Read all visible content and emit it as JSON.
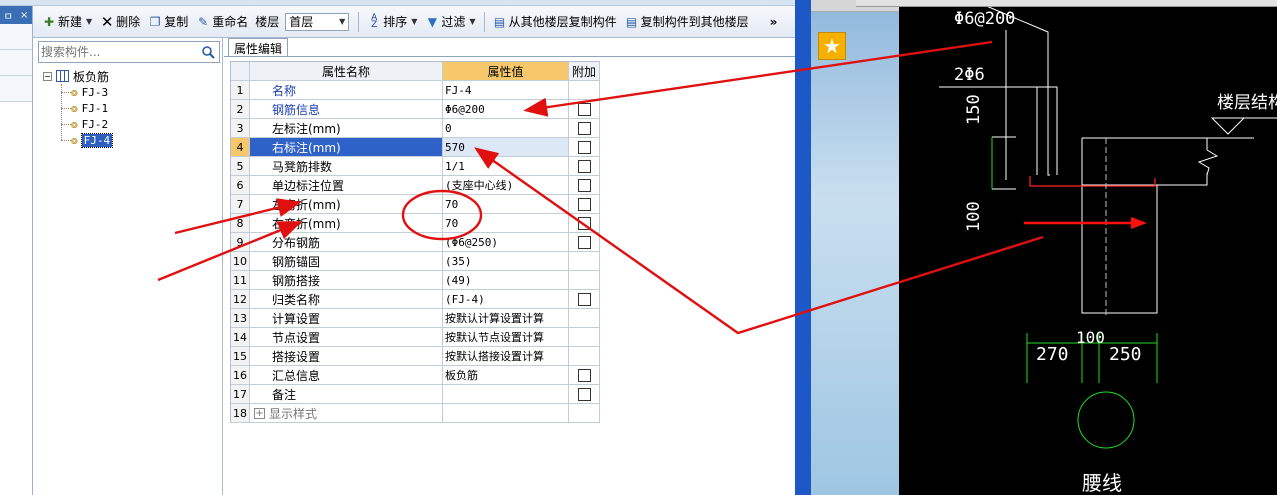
{
  "toolbar": {
    "new_label": "新建",
    "delete_label": "删除",
    "copy_label": "复制",
    "rename_label": "重命名",
    "floor_label": "楼层",
    "floor_value": "首层",
    "sort_label": "排序",
    "filter_label": "过滤",
    "copy_from_floor_label": "从其他楼层复制构件",
    "copy_to_floor_label": "复制构件到其他楼层",
    "more_label": "»"
  },
  "left_stub": {
    "pin_label": "ㅁ",
    "close_label": "×"
  },
  "search": {
    "placeholder": "搜索构件..."
  },
  "tree": {
    "root_label": "板负筋",
    "items": [
      {
        "label": "FJ-3"
      },
      {
        "label": "FJ-1"
      },
      {
        "label": "FJ-2"
      },
      {
        "label": "FJ-4",
        "selected": true
      }
    ]
  },
  "property_panel": {
    "tab_label": "属性编辑",
    "headers": {
      "name": "属性名称",
      "value": "属性值",
      "extra": "附加"
    },
    "rows": [
      {
        "n": "1",
        "name": "名称",
        "value": "FJ-4",
        "style": "blue",
        "checkbox": false
      },
      {
        "n": "2",
        "name": "钢筋信息",
        "value": "Φ6@200",
        "style": "blue",
        "checkbox": true
      },
      {
        "n": "3",
        "name": "左标注(mm)",
        "value": "0",
        "style": "",
        "checkbox": true
      },
      {
        "n": "4",
        "name": "右标注(mm)",
        "value": "570",
        "style": "selected",
        "checkbox": true
      },
      {
        "n": "5",
        "name": "马凳筋排数",
        "value": "1/1",
        "style": "",
        "checkbox": true
      },
      {
        "n": "6",
        "name": "单边标注位置",
        "value": "(支座中心线)",
        "style": "",
        "checkbox": true
      },
      {
        "n": "7",
        "name": "左弯折(mm)",
        "value": "70",
        "style": "",
        "checkbox": true
      },
      {
        "n": "8",
        "name": "右弯折(mm)",
        "value": "70",
        "style": "",
        "checkbox": true
      },
      {
        "n": "9",
        "name": "分布钢筋",
        "value": "(Φ6@250)",
        "style": "",
        "checkbox": true
      },
      {
        "n": "10",
        "name": "钢筋锚固",
        "value": "(35)",
        "style": "",
        "checkbox": false
      },
      {
        "n": "11",
        "name": "钢筋搭接",
        "value": "(49)",
        "style": "",
        "checkbox": false
      },
      {
        "n": "12",
        "name": "归类名称",
        "value": "(FJ-4)",
        "style": "",
        "checkbox": true
      },
      {
        "n": "13",
        "name": "计算设置",
        "value": "按默认计算设置计算",
        "style": "",
        "checkbox": false
      },
      {
        "n": "14",
        "name": "节点设置",
        "value": "按默认节点设置计算",
        "style": "",
        "checkbox": false
      },
      {
        "n": "15",
        "name": "搭接设置",
        "value": "按默认搭接设置计算",
        "style": "",
        "checkbox": false
      },
      {
        "n": "16",
        "name": "汇总信息",
        "value": "板负筋",
        "style": "",
        "checkbox": true
      },
      {
        "n": "17",
        "name": "备注",
        "value": "",
        "style": "",
        "checkbox": true
      },
      {
        "n": "18",
        "name": "显示样式",
        "value": "",
        "style": "gray-expand",
        "checkbox": false
      }
    ]
  },
  "cad_drawing": {
    "rebar_label": "Φ6@200",
    "bar_label": "2Φ6",
    "dim_150": "150",
    "dim_100_vertical": "100",
    "floor_elevation_label": "楼层结构",
    "dim_270": "270",
    "dim_100": "100",
    "dim_250": "250",
    "bottom_label": "腰线"
  },
  "colors": {
    "annotation": "#e01010",
    "selection": "#2f62c8",
    "header_highlight": "#f7c86b",
    "cad_white": "#ffffff",
    "cad_green": "#22dd22",
    "cad_red": "#ff2020"
  }
}
